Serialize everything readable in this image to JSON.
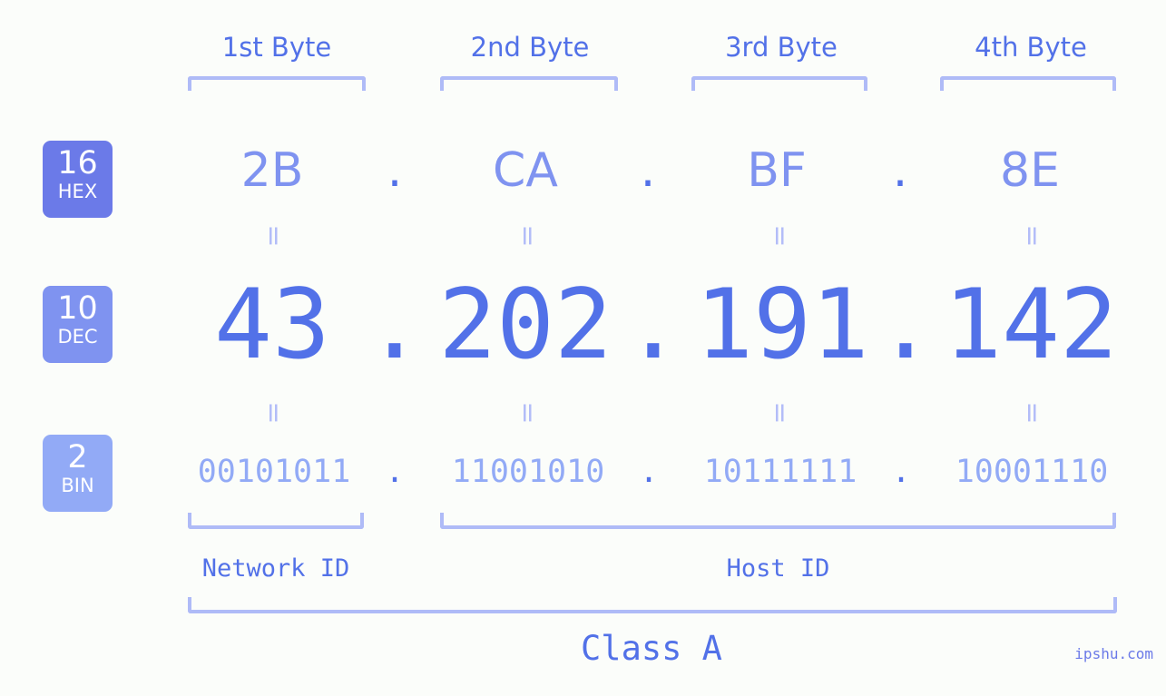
{
  "meta": {
    "watermark": "ipshu.com",
    "background_color": "#fbfdfa",
    "accent_color": "#5271e8",
    "accent_light": "#7f93f0",
    "accent_lighter": "#92aaf6",
    "bracket_color": "#afbbf7",
    "equals_color": "#b3bdf8"
  },
  "headers": [
    {
      "label": "1st Byte"
    },
    {
      "label": "2nd Byte"
    },
    {
      "label": "3rd Byte"
    },
    {
      "label": "4th Byte"
    }
  ],
  "badges": [
    {
      "num": "16",
      "sub": "HEX",
      "color": "#6b7ae8"
    },
    {
      "num": "10",
      "sub": "DEC",
      "color": "#7f93f0"
    },
    {
      "num": "2",
      "sub": "BIN",
      "color": "#92aaf6"
    }
  ],
  "separator": ".",
  "equals_mark": "=",
  "rows": {
    "hex": {
      "base": "16",
      "label": "HEX",
      "octets": [
        "2B",
        "CA",
        "BF",
        "8E"
      ]
    },
    "dec": {
      "base": "10",
      "label": "DEC",
      "octets": [
        "43",
        "202",
        "191",
        "142"
      ]
    },
    "bin": {
      "base": "2",
      "label": "BIN",
      "octets": [
        "00101011",
        "11001010",
        "10111111",
        "10001110"
      ]
    }
  },
  "spans": {
    "network_id": "Network ID",
    "host_id": "Host ID",
    "class": "Class A"
  },
  "chart_data": {
    "type": "table",
    "title": "IPv4 Address Byte Breakdown",
    "ip_decimal": "43.202.191.142",
    "ip_hex": "2B.CA.BF.8E",
    "ip_binary": "00101011.11001010.10111111.10001110",
    "address_class": "Class A",
    "network_id_bytes": 1,
    "host_id_bytes": 3,
    "categories": [
      "1st Byte",
      "2nd Byte",
      "3rd Byte",
      "4th Byte"
    ],
    "series": [
      {
        "name": "HEX",
        "values": [
          "2B",
          "CA",
          "BF",
          "8E"
        ]
      },
      {
        "name": "DEC",
        "values": [
          43,
          202,
          191,
          142
        ]
      },
      {
        "name": "BIN",
        "values": [
          "00101011",
          "11001010",
          "10111111",
          "10001110"
        ]
      }
    ]
  }
}
